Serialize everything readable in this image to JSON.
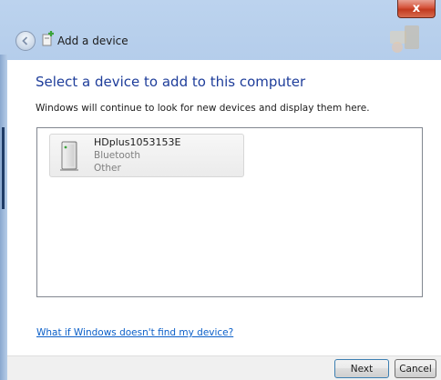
{
  "window": {
    "title": "Add a device",
    "close_label": "x"
  },
  "main": {
    "heading": "Select a device to add to this computer",
    "subtext": "Windows will continue to look for new devices and display them here.",
    "devices": [
      {
        "name": "HDplus1053153E",
        "type": "Bluetooth",
        "category": "Other"
      }
    ],
    "help_link": "What if Windows doesn't find my device?"
  },
  "footer": {
    "next_label": "Next",
    "cancel_label": "Cancel"
  },
  "colors": {
    "heading": "#1e3d9a",
    "link": "#0b5fc8",
    "close_button": "#c23a1f"
  },
  "icons": {
    "back": "back-arrow-icon",
    "title": "add-device-icon",
    "device": "generic-device-icon"
  }
}
